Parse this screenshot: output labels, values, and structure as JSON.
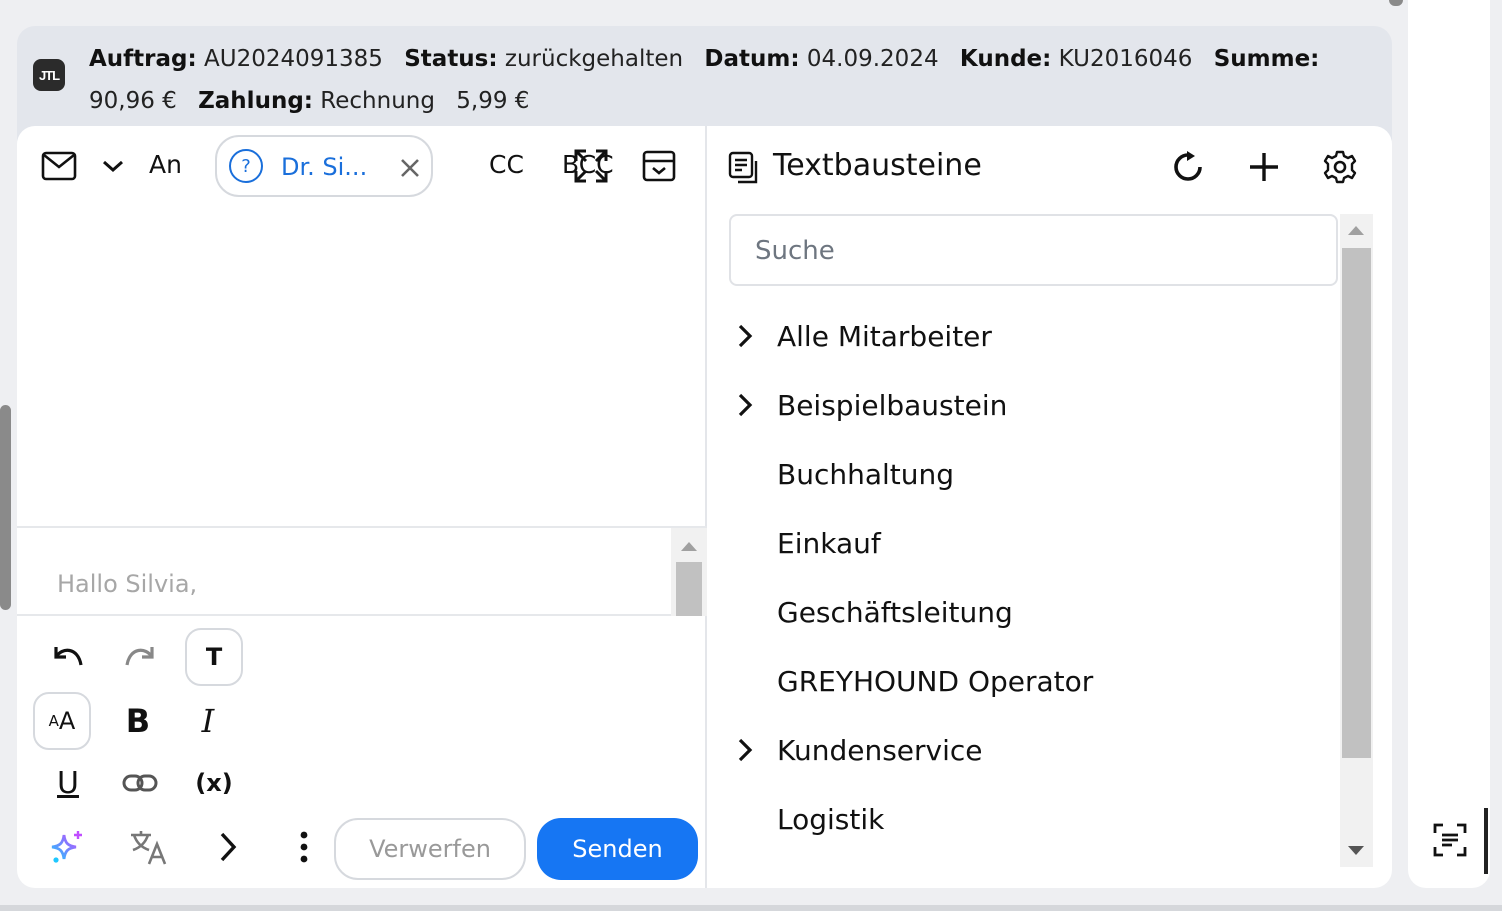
{
  "order": {
    "fields": [
      {
        "label": "Auftrag:",
        "value": "AU2024091385"
      },
      {
        "label": "Status:",
        "value": "zurückgehalten"
      },
      {
        "label": "Datum:",
        "value": "04.09.2024"
      },
      {
        "label": "Kunde:",
        "value": "KU2016046"
      },
      {
        "label": "Summe:",
        "value": "90,96 €"
      },
      {
        "label": "Zahlung:",
        "value": "Rechnung"
      }
    ],
    "extra": "5,99 €",
    "logo_text": "JTL"
  },
  "mail": {
    "to_label": "An",
    "recipient_chip": "Dr. Si...",
    "cc_label": "CC",
    "bcc_label": "BCC",
    "body_preview": "Hallo Silvia,",
    "discard_label": "Verwerfen",
    "send_label": "Senden"
  },
  "toolbar": {
    "text_style_glyph": "T",
    "font_size_small": "A",
    "font_size_large": "A",
    "bold_glyph": "B",
    "italic_glyph": "I",
    "underline_glyph": "U",
    "variable_glyph": "(x)"
  },
  "textmodules": {
    "title": "Textbausteine",
    "search_placeholder": "Suche",
    "items": [
      {
        "label": "Alle Mitarbeiter",
        "expandable": true
      },
      {
        "label": "Beispielbaustein",
        "expandable": true
      },
      {
        "label": "Buchhaltung",
        "expandable": false
      },
      {
        "label": "Einkauf",
        "expandable": false
      },
      {
        "label": "Geschäftsleitung",
        "expandable": false
      },
      {
        "label": "GREYHOUND Operator",
        "expandable": false
      },
      {
        "label": "Kundenservice",
        "expandable": true
      },
      {
        "label": "Logistik",
        "expandable": false
      }
    ]
  },
  "colors": {
    "accent": "#1676f3",
    "chip_text": "#1a6fdb"
  }
}
